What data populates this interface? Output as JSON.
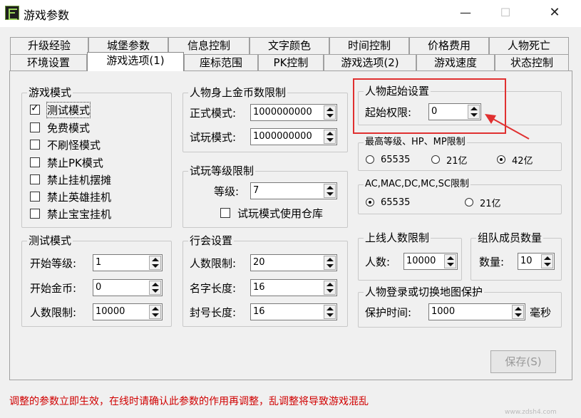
{
  "window": {
    "title": "游戏参数",
    "min": "—",
    "max": "☐",
    "close": "✕"
  },
  "tabs_back": [
    "升级经验",
    "城堡参数",
    "信息控制",
    "文字颜色",
    "时间控制",
    "价格费用",
    "人物死亡"
  ],
  "tabs_front": [
    "环境设置",
    "游戏选项(1)",
    "座标范围",
    "PK控制",
    "游戏选项(2)",
    "游戏速度",
    "状态控制"
  ],
  "game_mode": {
    "title": "游戏模式",
    "items": [
      {
        "label": "测试模式",
        "checked": true
      },
      {
        "label": "免费模式",
        "checked": false
      },
      {
        "label": "不刷怪模式",
        "checked": false
      },
      {
        "label": "禁止PK模式",
        "checked": false
      },
      {
        "label": "禁止挂机摆摊",
        "checked": false
      },
      {
        "label": "禁止英雄挂机",
        "checked": false
      },
      {
        "label": "禁止宝宝挂机",
        "checked": false
      }
    ]
  },
  "test_mode": {
    "title": "测试模式",
    "start_level_label": "开始等级:",
    "start_level": "1",
    "start_gold_label": "开始金币:",
    "start_gold": "0",
    "limit_label": "人数限制:",
    "limit": "10000"
  },
  "gold_limit": {
    "title": "人物身上金币数限制",
    "formal_label": "正式模式:",
    "formal": "1000000000",
    "trial_label": "试玩模式:",
    "trial": "1000000000"
  },
  "trial_level": {
    "title": "试玩等级限制",
    "level_label": "等级:",
    "level": "7",
    "warehouse_label": "试玩模式使用仓库",
    "warehouse_checked": false
  },
  "guild": {
    "title": "行会设置",
    "limit_label": "人数限制:",
    "limit": "20",
    "name_label": "名字长度:",
    "name_len": "16",
    "seal_label": "封号长度:",
    "seal_len": "16"
  },
  "start_perm": {
    "title": "人物起始设置",
    "label": "起始权限:",
    "value": "0"
  },
  "max_level": {
    "title": "最高等级、HP、MP限制",
    "options": [
      {
        "label": "65535",
        "on": false
      },
      {
        "label": "21亿",
        "on": false
      },
      {
        "label": "42亿",
        "on": true
      }
    ]
  },
  "ac_limit": {
    "title": "AC,MAC,DC,MC,SC限制",
    "options": [
      {
        "label": "65535",
        "on": true
      },
      {
        "label": "21亿",
        "on": false
      }
    ]
  },
  "online_limit": {
    "title": "上线人数限制",
    "label": "人数:",
    "value": "10000"
  },
  "team_size": {
    "title": "组队成员数量",
    "label": "数量:",
    "value": "10"
  },
  "map_protect": {
    "title": "人物登录或切换地图保护",
    "label": "保护时间:",
    "value": "1000",
    "unit": "毫秒"
  },
  "save_label": "保存(S)",
  "warning": "调整的参数立即生效，在线时请确认此参数的作用再调整，乱调整将导致游戏混乱",
  "watermark": "www.zdsh4.com",
  "colors": {
    "warning": "#d00000",
    "highlight": "#e03030"
  }
}
